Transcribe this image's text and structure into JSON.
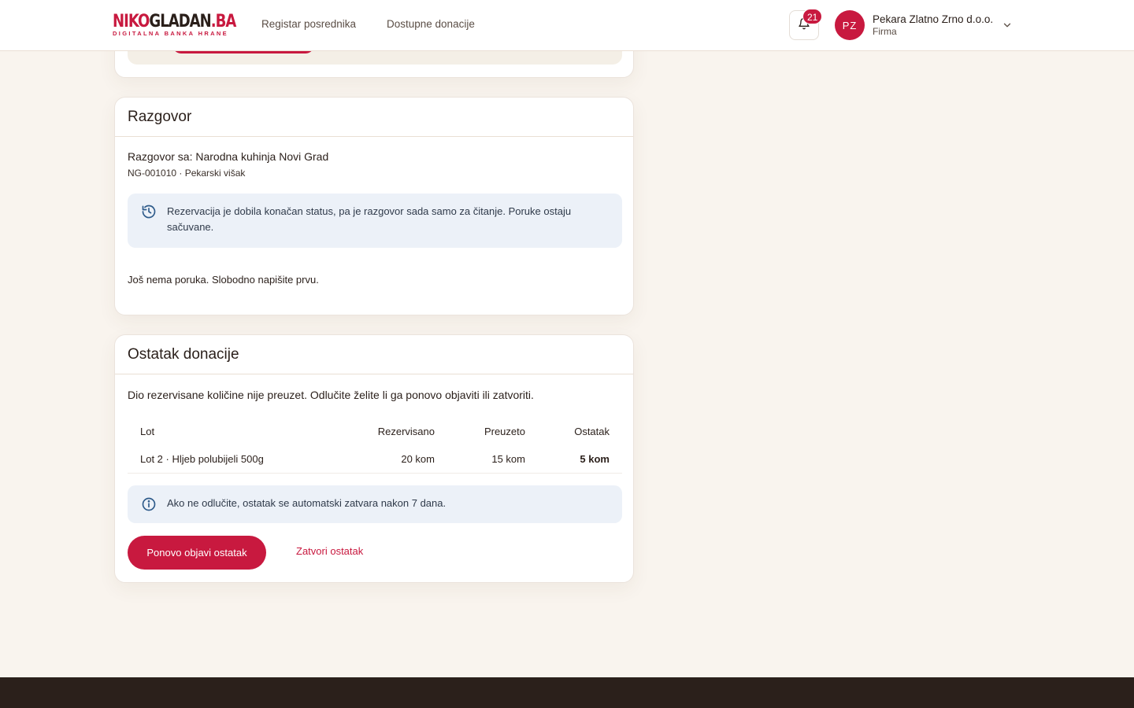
{
  "brand": {
    "logo_red": "NIKO",
    "logo_dark": "GLADAN",
    "logo_tld": ".BA",
    "tagline": "DIGITALNA BANKA HRANE"
  },
  "nav": {
    "items": [
      {
        "label": "Registar posrednika"
      },
      {
        "label": "Dostupne donacije"
      }
    ]
  },
  "notifications": {
    "count": "21",
    "icon": "bell-icon"
  },
  "account": {
    "initials": "PZ",
    "name": "Pekara Zlatno Zrno d.o.o.",
    "role": "Firma"
  },
  "conversation": {
    "title": "Razgovor",
    "with": "Razgovor sa: Narodna kuhinja Novi Grad",
    "meta": "NG-001010 · Pekarski višak",
    "notice_line1": "Rezervacija je dobila konačan status, pa je razgovor sada samo za čitanje. Poruke ostaju",
    "notice_line2": "sačuvane.",
    "empty": "Još nema poruka. Slobodno napišite prvu."
  },
  "remainder": {
    "title": "Ostatak donacije",
    "description": "Dio rezervisane količine nije preuzet. Odlučite želite li ga ponovo objaviti ili zatvoriti.",
    "columns": [
      "Lot",
      "Rezervisano",
      "Preuzeto",
      "Ostatak"
    ],
    "rows": [
      {
        "lot": "Lot 2 · Hljeb polubijeli 500g",
        "reserved": "20 kom",
        "picked": "15 kom",
        "remaining": "5 kom"
      }
    ],
    "info": "Ako ne odlučite, ostatak se automatski zatvara nakon 7 dana.",
    "republish_label": "Ponovo objavi ostatak",
    "close_label": "Zatvori ostatak"
  },
  "colors": {
    "accent": "#c8193f",
    "background": "#f9f4ee",
    "notice_bg": "#ecf1f8",
    "footer": "#2b201b"
  }
}
